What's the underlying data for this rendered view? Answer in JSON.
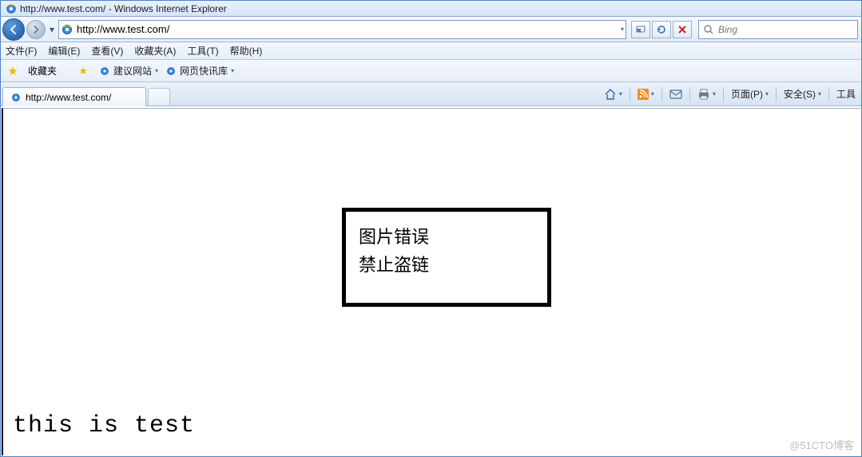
{
  "window": {
    "title": "http://www.test.com/ - Windows Internet Explorer"
  },
  "address": {
    "url": "http://www.test.com/"
  },
  "search": {
    "placeholder": "Bing"
  },
  "menu": {
    "file": "文件(F)",
    "edit": "编辑(E)",
    "view": "查看(V)",
    "favorites": "收藏夹(A)",
    "tools": "工具(T)",
    "help": "帮助(H)"
  },
  "favbar": {
    "label": "收藏夹",
    "suggested": "建议网站",
    "slice": "网页快讯库"
  },
  "tab": {
    "title": "http://www.test.com/"
  },
  "cmd": {
    "page": "页面(P)",
    "safety": "安全(S)",
    "tools": "工具"
  },
  "content": {
    "err_line1": "图片错误",
    "err_line2": "禁止盗链",
    "body_text": "this is test"
  },
  "watermark": "@51CTO博客"
}
